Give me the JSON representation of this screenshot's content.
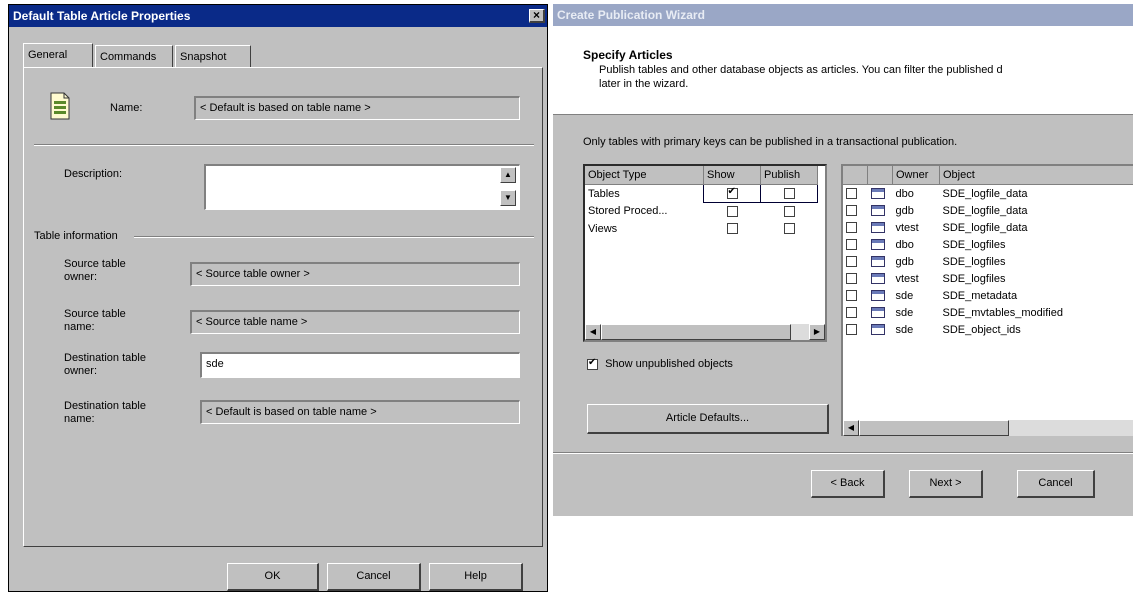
{
  "left_dialog": {
    "title": "Default Table Article Properties",
    "title_bar_color": "#0a2a88",
    "close_label": "×",
    "tabs": [
      "General",
      "Commands",
      "Snapshot"
    ],
    "name_label": "Name:",
    "name_value": "< Default is based on table name >",
    "description_label": "Description:",
    "description_value": "",
    "table_info_label": "Table information",
    "source_owner_label": "Source table owner:",
    "source_owner_value": "< Source table owner >",
    "source_name_label": "Source table name:",
    "source_name_value": "< Source table name >",
    "dest_owner_label": "Destination table owner:",
    "dest_owner_value": "sde",
    "dest_name_label": "Destination table name:",
    "dest_name_value": "< Default is based on table name >",
    "ok_label": "OK",
    "cancel_label": "Cancel",
    "help_label": "Help"
  },
  "wizard": {
    "title": "Create Publication Wizard",
    "title_bar_color": "#9aa7c6",
    "heading": "Specify Articles",
    "subtitle_line1": "Publish tables and other database objects as articles. You can filter the published d",
    "subtitle_line2": "later in the wizard.",
    "note": "Only tables with primary keys can be published in a transactional publication.",
    "object_types": {
      "headers": [
        "Object Type",
        "Show",
        "Publish"
      ],
      "rows": [
        {
          "type": "Tables",
          "show": true,
          "publish": false
        },
        {
          "type": "Stored Proced...",
          "show": false,
          "publish": false
        },
        {
          "type": "Views",
          "show": false,
          "publish": false
        }
      ]
    },
    "show_unpublished_label": "Show unpublished objects",
    "show_unpublished_checked": true,
    "article_defaults_label": "Article Defaults...",
    "objects": {
      "headers": [
        "",
        "",
        "Owner",
        "Object"
      ],
      "rows": [
        {
          "owner": "dbo",
          "object": "SDE_logfile_data"
        },
        {
          "owner": "gdb",
          "object": "SDE_logfile_data"
        },
        {
          "owner": "vtest",
          "object": "SDE_logfile_data"
        },
        {
          "owner": "dbo",
          "object": "SDE_logfiles"
        },
        {
          "owner": "gdb",
          "object": "SDE_logfiles"
        },
        {
          "owner": "vtest",
          "object": "SDE_logfiles"
        },
        {
          "owner": "sde",
          "object": "SDE_metadata"
        },
        {
          "owner": "sde",
          "object": "SDE_mvtables_modified"
        },
        {
          "owner": "sde",
          "object": "SDE_object_ids"
        }
      ]
    },
    "back_label": "< Back",
    "next_label": "Next >",
    "cancel_label": "Cancel"
  }
}
